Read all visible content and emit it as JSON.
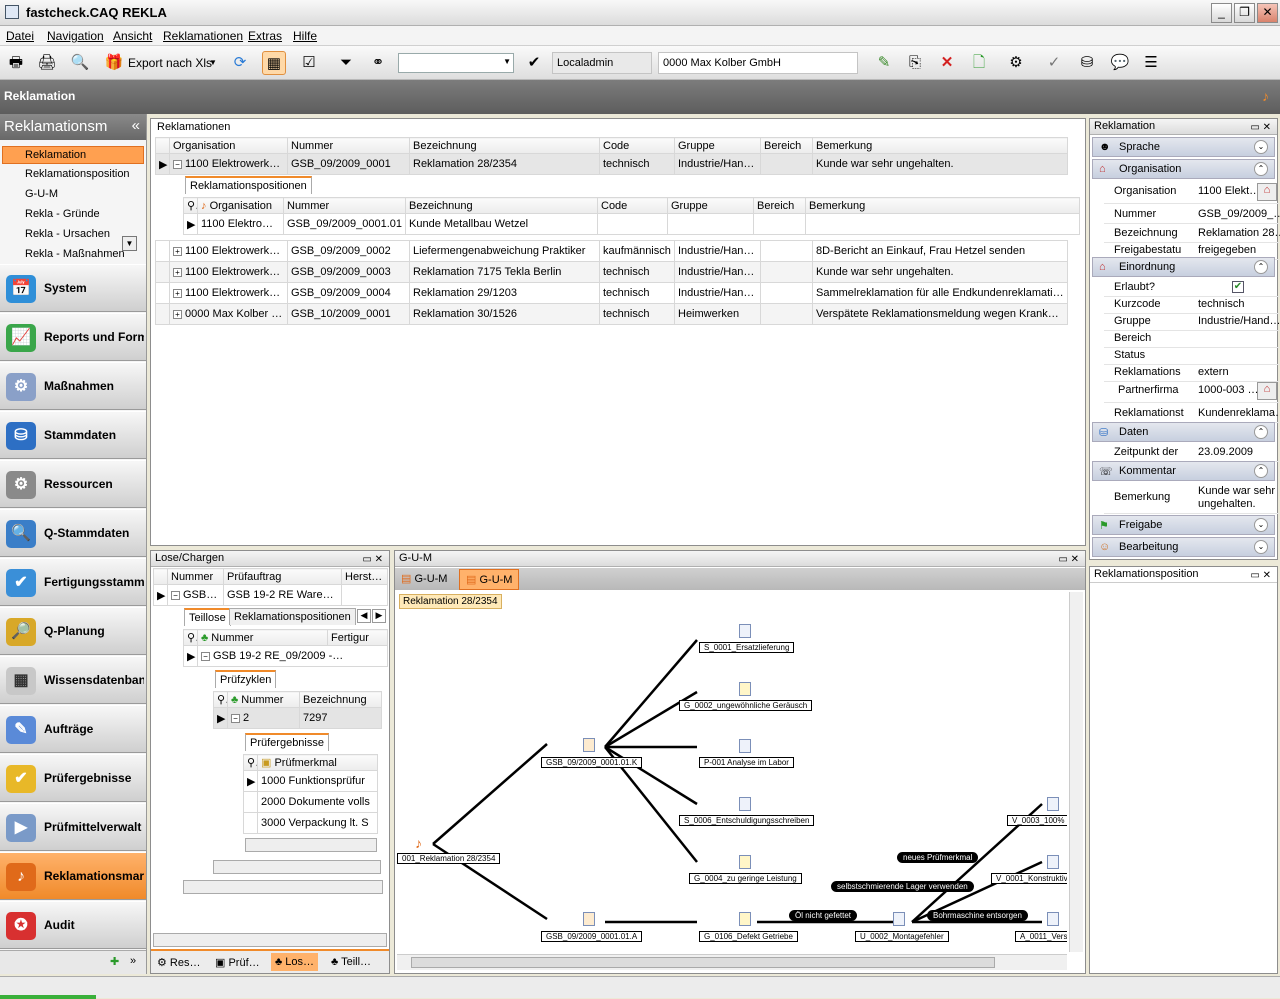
{
  "window": {
    "title": "fastcheck.CAQ REKLA"
  },
  "menu": [
    "Datei",
    "Navigation",
    "Ansicht",
    "Reklamationen",
    "Extras",
    "Hilfe"
  ],
  "toolbar": {
    "export_label": "Export nach Xls",
    "user": "Localadmin",
    "company": "0000 Max Kolber GmbH"
  },
  "header": {
    "title": "Reklamation"
  },
  "sidebar": {
    "title": "Reklamationsm",
    "items": [
      "Reklamation",
      "Reklamationsposition",
      "G-U-M",
      "Rekla - Gründe",
      "Rekla - Ursachen",
      "Rekla - Maßnahmen"
    ],
    "nav": [
      "System",
      "Reports und Form",
      "Maßnahmen",
      "Stammdaten",
      "Ressourcen",
      "Q-Stammdaten",
      "Fertigungsstamm",
      "Q-Planung",
      "Wissensdatenban",
      "Aufträge",
      "Prüfergebnisse",
      "Prüfmittelverwalt",
      "Reklamationsmar",
      "Audit"
    ]
  },
  "reklamationen": {
    "title": "Reklamationen",
    "columns": [
      "Organisation",
      "Nummer",
      "Bezeichnung",
      "Code",
      "Gruppe",
      "Bereich",
      "Bemerkung"
    ],
    "rows": [
      [
        "1100 Elektrowerk…",
        "GSB_09/2009_0001",
        "Reklamation 28/2354",
        "technisch",
        "Industrie/Han…",
        "",
        "Kunde war sehr ungehalten."
      ],
      [
        "1100 Elektrowerk…",
        "GSB_09/2009_0002",
        "Liefermengenabweichung Praktiker",
        "kaufmännisch",
        "Industrie/Han…",
        "",
        "8D-Bericht an Einkauf, Frau Hetzel senden"
      ],
      [
        "1100 Elektrowerk…",
        "GSB_09/2009_0003",
        "Reklamation 7175 Tekla Berlin",
        "technisch",
        "Industrie/Han…",
        "",
        "Kunde war sehr ungehalten."
      ],
      [
        "1100 Elektrowerk…",
        "GSB_09/2009_0004",
        "Reklamation 29/1203",
        "technisch",
        "Industrie/Han…",
        "",
        "Sammelreklamation für alle Endkundenreklamation…"
      ],
      [
        "0000 Max Kolber …",
        "GSB_10/2009_0001",
        "Reklamation 30/1526",
        "technisch",
        "Heimwerken",
        "",
        "Verspätete Reklamationsmeldung wegen Krankhei…"
      ]
    ],
    "sub_tab": "Reklamationspositionen",
    "sub_columns": [
      "Organisation",
      "Nummer",
      "Bezeichnung",
      "Code",
      "Gruppe",
      "Bereich",
      "Bemerkung"
    ],
    "sub_row": [
      "1100 Elektrow…",
      "GSB_09/2009_0001.01",
      "Kunde Metallbau Wetzel",
      "",
      "",
      "",
      ""
    ]
  },
  "lose": {
    "title": "Lose/Chargen",
    "columns": [
      "Nummer",
      "Prüfauftrag",
      "Herstellm"
    ],
    "row": [
      "GSB …",
      "GSB 19-2 RE Warena…"
    ],
    "tabs": [
      "Teillose",
      "Reklamationspositionen"
    ],
    "teillose_cols": [
      "Nummer",
      "Fertigur"
    ],
    "teillose_row": "GSB 19-2 RE_09/2009 -…",
    "pz_tab": "Prüfzyklen",
    "pz_cols": [
      "Nummer",
      "Bezeichnung"
    ],
    "pz_row": [
      "2",
      "7297"
    ],
    "pe_tab": "Prüfergebnisse",
    "pe_col": "Prüfmerkmal",
    "pe_rows": [
      "1000 Funktionsprüfur",
      "2000 Dokumente volls",
      "3000 Verpackung lt. S"
    ],
    "bottom_tabs": [
      "Res…",
      "Prüf…",
      "Los…",
      "Teill…"
    ]
  },
  "gum": {
    "title": "G-U-M",
    "tabs": [
      "G-U-M",
      "G-U-M"
    ],
    "tooltip": "Reklamation 28/2354",
    "nodes": {
      "root": "001_Reklamation 28/2354",
      "pos1": "GSB_09/2009_0001.01.K",
      "pos2": "GSB_09/2009_0001.01.A",
      "s1": "S_0001_Ersatzlieferung",
      "g2": "G_0002_ungewöhnliche Geräusch",
      "p1": "P-001 Analyse im Labor",
      "s6": "S_0006_Entschuldigungsschreiben",
      "g4": "G_0004_zu geringe Leistung",
      "g106": "G_0106_Defekt Getriebe",
      "u2": "U_0002_Montagefehler",
      "v3": "V_0003_100% P",
      "v1": "V_0001_Konstruktive",
      "a11": "A_0011_Versc"
    },
    "blobs": [
      "neues Prüfmerkmal",
      "selbstschmierende Lager verwenden",
      "Öl nicht gefettet",
      "Bohrmaschine entsorgen"
    ]
  },
  "props": {
    "title": "Reklamation",
    "groups": [
      "Sprache",
      "Organisation",
      "Einordnung",
      "Daten",
      "Kommentar",
      "Freigabe",
      "Bearbeitung"
    ],
    "org": [
      [
        "Organisation",
        "1100 Elekt…"
      ],
      [
        "Nummer",
        "GSB_09/2009_…"
      ],
      [
        "Bezeichnung",
        "Reklamation 28…"
      ],
      [
        "Freigabestatu",
        "freigegeben"
      ]
    ],
    "einordnung": [
      [
        "Erlaubt?",
        ""
      ],
      [
        "Kurzcode",
        "technisch"
      ],
      [
        "Gruppe",
        "Industrie/Hand…"
      ],
      [
        "Bereich",
        ""
      ],
      [
        "Status",
        ""
      ],
      [
        "Reklamations",
        "extern"
      ],
      [
        "Partnerfirma",
        "1000-003 …"
      ],
      [
        "Reklamationst",
        "Kundenreklama…"
      ]
    ],
    "daten": [
      [
        "Zeitpunkt der",
        "23.09.2009"
      ]
    ],
    "kommentar": [
      [
        "Bemerkung",
        "Kunde war sehr ungehalten."
      ]
    ]
  },
  "pos_panel": {
    "title": "Reklamationsposition"
  }
}
